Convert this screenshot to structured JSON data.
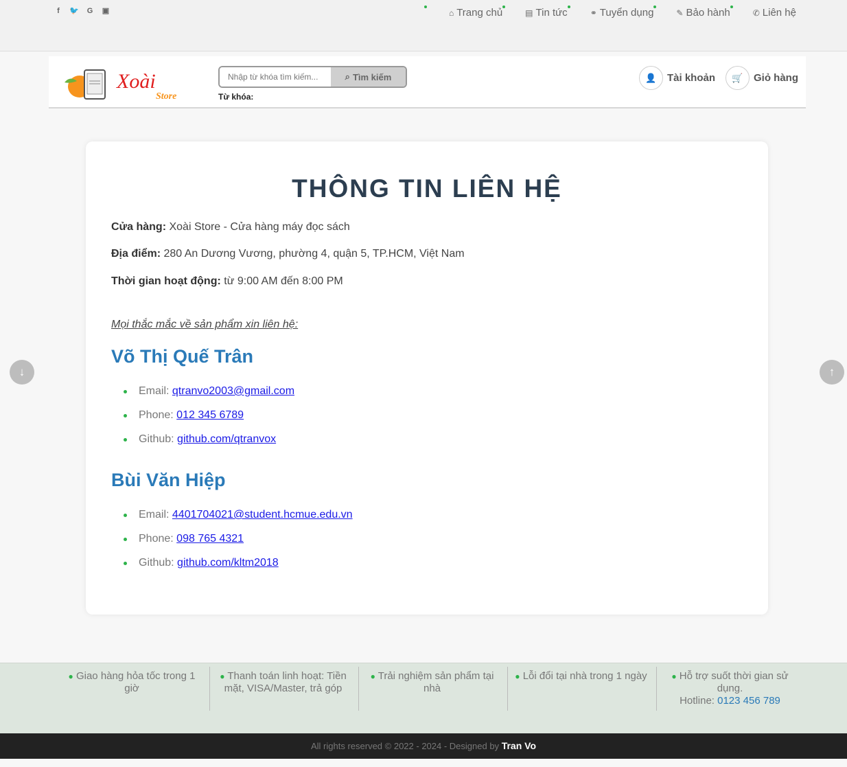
{
  "topbar": {
    "social": [
      "f",
      "y",
      "G",
      "yt"
    ],
    "nav": [
      {
        "icon": "home-icon",
        "glyph": "⌂",
        "label": "Trang chủ"
      },
      {
        "icon": "newspaper-icon",
        "glyph": "▤",
        "label": "Tin tức"
      },
      {
        "icon": "handshake-icon",
        "glyph": "⚭",
        "label": "Tuyển dụng"
      },
      {
        "icon": "wrench-icon",
        "glyph": "🔧",
        "label": "Bảo hành"
      },
      {
        "icon": "phone-icon",
        "glyph": "✆",
        "label": "Liên hệ"
      }
    ]
  },
  "header": {
    "logo_text": "Xoài",
    "logo_sub": "Store",
    "search_placeholder": "Nhập từ khóa tìm kiếm...",
    "search_button": "Tìm kiếm",
    "keyword_label": "Từ khóa:",
    "keyword_value": "",
    "account_label": "Tài khoản",
    "cart_label": "Giỏ hàng"
  },
  "content": {
    "title": "THÔNG TIN LIÊN HỆ",
    "store_label": "Cửa hàng:",
    "store_value": "Xoài Store - Cửa hàng máy đọc sách",
    "address_label": "Địa điểm:",
    "address_value": "280 An Dương Vương, phường 4, quận 5, TP.HCM, Việt Nam",
    "hours_label": "Thời gian hoạt động:",
    "hours_value": "từ 9:00 AM đến 8:00 PM",
    "ask": "Mọi thắc mắc về sản phẩm xin liên hệ:",
    "people": [
      {
        "name": "Võ Thị Quế Trân",
        "email_label": "Email:",
        "email": "qtranvo2003@gmail.com",
        "phone_label": "Phone:",
        "phone": "012 345 6789",
        "github_label": "Github:",
        "github": "github.com/qtranvox"
      },
      {
        "name": "Bùi Văn Hiệp",
        "email_label": "Email:",
        "email": "4401704021@student.hcmue.edu.vn",
        "phone_label": "Phone:",
        "phone": "098 765 4321",
        "github_label": "Github:",
        "github": "github.com/kltm2018"
      }
    ]
  },
  "features": [
    "Giao hàng hỏa tốc trong 1 giờ",
    "Thanh toán linh hoạt: Tiền mặt, VISA/Master, trả góp",
    "Trải nghiệm sản phẩm tại nhà",
    "Lỗi đổi tại nhà trong 1 ngày",
    "Hỗ trợ suốt thời gian sử dụng."
  ],
  "hotline_label": "Hotline:",
  "hotline": "0123 456 789",
  "copyright": "All rights reserved © 2022 - 2024 - Designed by",
  "designer": "Tran Vo",
  "colors": {
    "accent": "#2a7ab8",
    "dot": "#2db34a",
    "title": "#2c3e50"
  }
}
